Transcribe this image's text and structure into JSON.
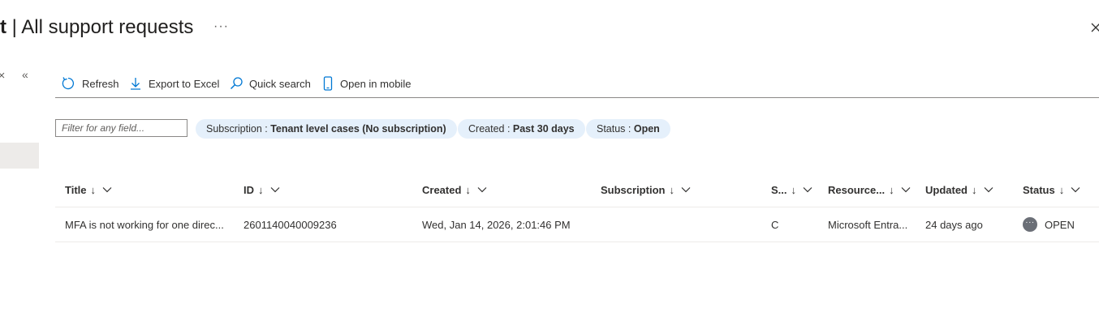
{
  "header": {
    "title_prefix": "t",
    "title_sep": " | ",
    "title": "All support requests",
    "more_label": "···"
  },
  "sidebar": {
    "collapse_label": "«"
  },
  "toolbar": {
    "refresh": "Refresh",
    "export": "Export to Excel",
    "quick_search": "Quick search",
    "open_mobile": "Open in mobile"
  },
  "filters": {
    "placeholder": "Filter for any field...",
    "pills": [
      {
        "key": "Subscription : ",
        "value": "Tenant level cases (No subscription)"
      },
      {
        "key": "Created : ",
        "value": "Past 30 days"
      },
      {
        "key": "Status : ",
        "value": "Open"
      }
    ]
  },
  "table": {
    "sort_arrow": "↓",
    "columns": [
      "Title",
      "ID",
      "Created",
      "Subscription",
      "S...",
      "Resource...",
      "Updated",
      "Status"
    ],
    "rows": [
      {
        "title": "MFA is not working for one direc...",
        "id": "2601140040009236",
        "created": "Wed, Jan 14, 2026, 2:01:46 PM",
        "subscription": "",
        "severity": "C",
        "resource": "Microsoft Entra...",
        "updated": "24 days ago",
        "status": "OPEN"
      }
    ]
  },
  "colors": {
    "accent": "#0078d4",
    "pill_bg": "#e5f0fb",
    "status_dot": "#6b6f77"
  }
}
